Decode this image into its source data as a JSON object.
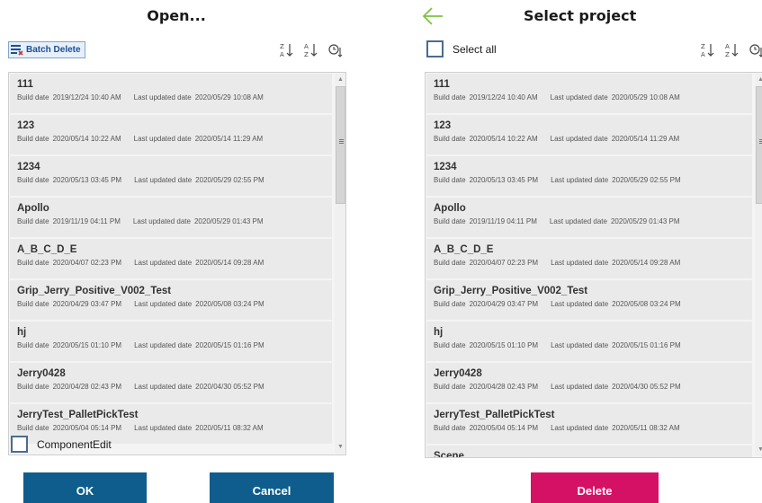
{
  "open_dialog": {
    "title": "Open...",
    "batch_delete_label": "Batch Delete",
    "component_edit_label": "ComponentEdit",
    "ok_label": "OK",
    "cancel_label": "Cancel",
    "items": [
      {
        "name": "111",
        "build_label": "Build date",
        "build": "2019/12/24 10:40 AM",
        "updated_label": "Last updated date",
        "updated": "2020/05/29 10:08 AM"
      },
      {
        "name": "123",
        "build_label": "Build date",
        "build": "2020/05/14 10:22 AM",
        "updated_label": "Last updated date",
        "updated": "2020/05/14 11:29 AM"
      },
      {
        "name": "1234",
        "build_label": "Build date",
        "build": "2020/05/13 03:45 PM",
        "updated_label": "Last updated date",
        "updated": "2020/05/29 02:55 PM"
      },
      {
        "name": "Apollo",
        "build_label": "Build date",
        "build": "2019/11/19 04:11 PM",
        "updated_label": "Last updated date",
        "updated": "2020/05/29 01:43 PM"
      },
      {
        "name": "A_B_C_D_E",
        "build_label": "Build date",
        "build": "2020/04/07 02:23 PM",
        "updated_label": "Last updated date",
        "updated": "2020/05/14 09:28 AM"
      },
      {
        "name": "Grip_Jerry_Positive_V002_Test",
        "build_label": "Build date",
        "build": "2020/04/29 03:47 PM",
        "updated_label": "Last updated date",
        "updated": "2020/05/08 03:24 PM"
      },
      {
        "name": "hj",
        "build_label": "Build date",
        "build": "2020/05/15 01:10 PM",
        "updated_label": "Last updated date",
        "updated": "2020/05/15 01:16 PM"
      },
      {
        "name": "Jerry0428",
        "build_label": "Build date",
        "build": "2020/04/28 02:43 PM",
        "updated_label": "Last updated date",
        "updated": "2020/04/30 05:52 PM"
      },
      {
        "name": "JerryTest_PalletPickTest",
        "build_label": "Build date",
        "build": "2020/05/04 05:14 PM",
        "updated_label": "Last updated date",
        "updated": "2020/05/11 08:32 AM"
      }
    ]
  },
  "select_dialog": {
    "title": "Select project",
    "select_all_label": "Select all",
    "delete_label": "Delete",
    "items": [
      {
        "name": "111",
        "build_label": "Build date",
        "build": "2019/12/24 10:40 AM",
        "updated_label": "Last updated date",
        "updated": "2020/05/29 10:08 AM"
      },
      {
        "name": "123",
        "build_label": "Build date",
        "build": "2020/05/14 10:22 AM",
        "updated_label": "Last updated date",
        "updated": "2020/05/14 11:29 AM"
      },
      {
        "name": "1234",
        "build_label": "Build date",
        "build": "2020/05/13 03:45 PM",
        "updated_label": "Last updated date",
        "updated": "2020/05/29 02:55 PM"
      },
      {
        "name": "Apollo",
        "build_label": "Build date",
        "build": "2019/11/19 04:11 PM",
        "updated_label": "Last updated date",
        "updated": "2020/05/29 01:43 PM"
      },
      {
        "name": "A_B_C_D_E",
        "build_label": "Build date",
        "build": "2020/04/07 02:23 PM",
        "updated_label": "Last updated date",
        "updated": "2020/05/14 09:28 AM"
      },
      {
        "name": "Grip_Jerry_Positive_V002_Test",
        "build_label": "Build date",
        "build": "2020/04/29 03:47 PM",
        "updated_label": "Last updated date",
        "updated": "2020/05/08 03:24 PM"
      },
      {
        "name": "hj",
        "build_label": "Build date",
        "build": "2020/05/15 01:10 PM",
        "updated_label": "Last updated date",
        "updated": "2020/05/15 01:16 PM"
      },
      {
        "name": "Jerry0428",
        "build_label": "Build date",
        "build": "2020/04/28 02:43 PM",
        "updated_label": "Last updated date",
        "updated": "2020/04/30 05:52 PM"
      },
      {
        "name": "JerryTest_PalletPickTest",
        "build_label": "Build date",
        "build": "2020/05/04 05:14 PM",
        "updated_label": "Last updated date",
        "updated": "2020/05/11 08:32 AM"
      },
      {
        "name": "Scene",
        "build_label": "",
        "build": "",
        "updated_label": "",
        "updated": ""
      }
    ]
  },
  "icons": {
    "sort_desc": "sort-z-a-icon",
    "sort_asc": "sort-a-z-icon",
    "sort_time": "sort-by-time-icon",
    "back": "back-arrow-icon",
    "batch_delete": "batch-delete-icon"
  },
  "colors": {
    "primary_button": "#0e5d8c",
    "delete_button": "#d51166",
    "back_arrow": "#7fc241",
    "list_item_bg": "#eaeaea"
  }
}
